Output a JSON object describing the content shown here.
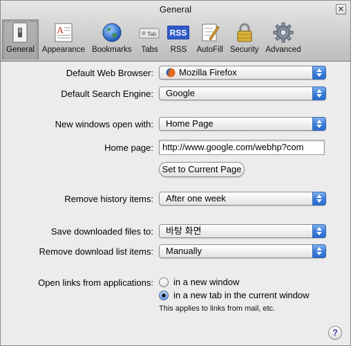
{
  "window": {
    "title": "General",
    "close_glyph": "✕"
  },
  "toolbar": {
    "items": [
      {
        "label": "General",
        "icon": "switch-icon",
        "active": true
      },
      {
        "label": "Appearance",
        "icon": "font-page-icon",
        "active": false
      },
      {
        "label": "Bookmarks",
        "icon": "globe-icon",
        "active": false
      },
      {
        "label": "Tabs",
        "icon": "tab-icon",
        "active": false,
        "icon_text": "Tab"
      },
      {
        "label": "RSS",
        "icon": "rss-icon",
        "active": false,
        "icon_text": "RSS"
      },
      {
        "label": "AutoFill",
        "icon": "autofill-pen-icon",
        "active": false
      },
      {
        "label": "Security",
        "icon": "padlock-icon",
        "active": false
      },
      {
        "label": "Advanced",
        "icon": "gear-icon",
        "active": false
      }
    ]
  },
  "settings": {
    "browser": {
      "label": "Default Web Browser:",
      "value": "Mozilla Firefox",
      "icon": "firefox-icon"
    },
    "search": {
      "label": "Default Search Engine:",
      "value": "Google"
    },
    "new_windows": {
      "label": "New windows open with:",
      "value": "Home Page"
    },
    "home_page": {
      "label": "Home page:",
      "value": "http://www.google.com/webhp?com"
    },
    "set_current_button": "Set to Current Page",
    "history": {
      "label": "Remove history items:",
      "value": "After one week"
    },
    "downloads": {
      "label": "Save downloaded files to:",
      "value": "바탕 화면"
    },
    "download_list": {
      "label": "Remove download list items:",
      "value": "Manually"
    },
    "open_links": {
      "label": "Open links from applications:",
      "option_new_window": "in a new window",
      "option_new_tab": "in a new tab in the current window",
      "selected": "new_tab",
      "note": "This applies to links from mail, etc."
    },
    "help_glyph": "?"
  },
  "colors": {
    "accent_blue": "#3d7fdb",
    "rss_blue": "#2e58c8"
  }
}
